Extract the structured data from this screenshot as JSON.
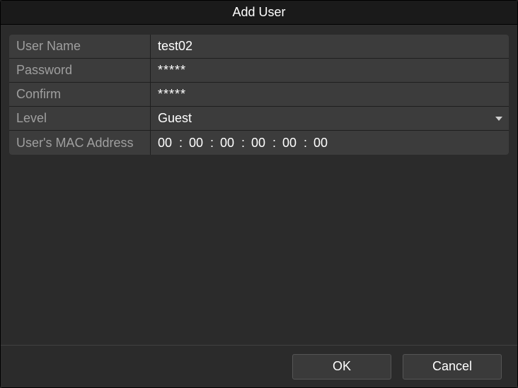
{
  "dialog": {
    "title": "Add User"
  },
  "form": {
    "username": {
      "label": "User Name",
      "value": "test02"
    },
    "password": {
      "label": "Password",
      "mask": "*****"
    },
    "confirm": {
      "label": "Confirm",
      "mask": "*****"
    },
    "level": {
      "label": "Level",
      "value": "Guest"
    },
    "mac": {
      "label": "User's MAC Address",
      "segs": [
        "00",
        "00",
        "00",
        "00",
        "00",
        "00"
      ]
    }
  },
  "buttons": {
    "ok": "OK",
    "cancel": "Cancel"
  }
}
